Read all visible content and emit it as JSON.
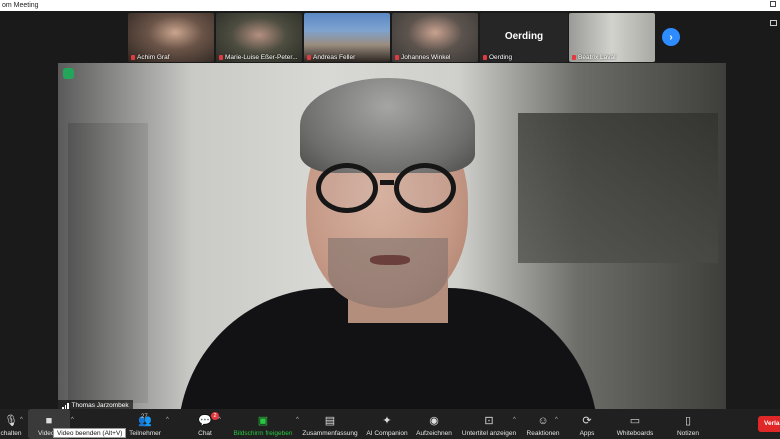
{
  "window": {
    "title": "om Meeting"
  },
  "participants": [
    {
      "name": "Achim Graf"
    },
    {
      "name": "Marie-Luise Eßer-Peter..."
    },
    {
      "name": "Andreas Feller"
    },
    {
      "name": "Johannes Winkel"
    },
    {
      "name": "Oerding",
      "display": "Oerding"
    },
    {
      "name": "Beatrix Laval"
    }
  ],
  "speaker": {
    "name": "Thomas Jarzombek"
  },
  "toolbar": {
    "items": [
      {
        "label": "chalten",
        "icon": "mic-icon"
      },
      {
        "label": "Video b",
        "icon": "video-icon"
      },
      {
        "label": "Teilnehmer",
        "icon": "participants-icon",
        "count": "27"
      },
      {
        "label": "Chat",
        "icon": "chat-icon",
        "badge": "2"
      },
      {
        "label": "Bildschirm freigeben",
        "icon": "share-screen-icon"
      },
      {
        "label": "Zusammenfassung",
        "icon": "summary-icon"
      },
      {
        "label": "AI Companion",
        "icon": "sparkle-icon"
      },
      {
        "label": "Aufzeichnen",
        "icon": "record-icon"
      },
      {
        "label": "Untertitel anzeigen",
        "icon": "captions-icon"
      },
      {
        "label": "Reaktionen",
        "icon": "reactions-icon"
      },
      {
        "label": "Apps",
        "icon": "apps-icon"
      },
      {
        "label": "Whiteboards",
        "icon": "whiteboard-icon"
      },
      {
        "label": "Notizen",
        "icon": "notes-icon"
      }
    ],
    "tooltip": "Video beenden (Alt+V)",
    "leave_label": "Verla"
  }
}
